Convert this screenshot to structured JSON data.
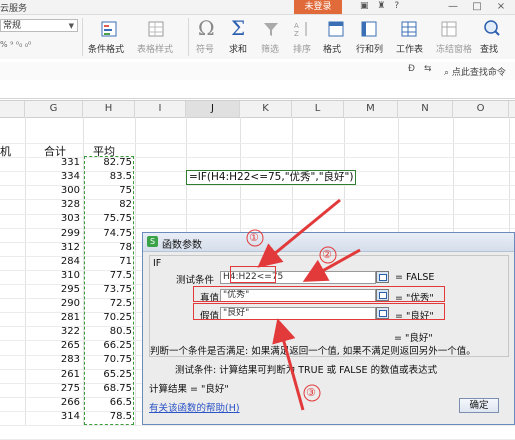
{
  "titlebar": {
    "service_label": "云服务",
    "login_label": "未登录",
    "icons": [
      "menu-icon",
      "shirt-icon",
      "help-icon"
    ],
    "window_buttons": [
      "—",
      "□",
      "×"
    ]
  },
  "ribbon": {
    "number_format": "常规",
    "number_format_row": "% ⁹ ⁰₀ ₀⁰",
    "items": [
      {
        "label": "条件格式",
        "dim": false
      },
      {
        "label": "表格样式",
        "dim": true
      },
      {
        "label": "符号",
        "dim": true
      },
      {
        "label": "求和",
        "dim": false
      },
      {
        "label": "筛选",
        "dim": true
      },
      {
        "label": "排序",
        "dim": true
      },
      {
        "label": "格式",
        "dim": false
      },
      {
        "label": "行和列",
        "dim": false
      },
      {
        "label": "工作表",
        "dim": false
      },
      {
        "label": "冻结窗格",
        "dim": true
      },
      {
        "label": "查找",
        "dim": false
      }
    ],
    "search_label": "点此查找命令"
  },
  "columns": [
    "G",
    "H",
    "I",
    "J",
    "K",
    "L",
    "M",
    "N",
    "O"
  ],
  "selected_column": "J",
  "sheet": {
    "left_partial": "机",
    "header_total": "合计",
    "header_avg": "平均",
    "total_values": [
      "331",
      "334",
      "300",
      "328",
      "303",
      "299",
      "312",
      "284",
      "310",
      "295",
      "290",
      "281",
      "322",
      "265",
      "283",
      "261",
      "275",
      "266",
      "314"
    ],
    "avg_values": [
      "82.75",
      "83.5",
      "75",
      "82",
      "75.75",
      "74.75",
      "78",
      "71",
      "77.5",
      "73.75",
      "72.5",
      "70.25",
      "80.5",
      "66.25",
      "70.75",
      "65.25",
      "68.75",
      "66.5",
      "78.5"
    ],
    "formula_cell": "=IF(H4:H22<=75,\"优秀\",\"良好\")"
  },
  "dialog": {
    "title": "函数参数",
    "function_name": "IF",
    "args": [
      {
        "label": "测试条件",
        "value": "H4:H22<=75",
        "result": "= FALSE"
      },
      {
        "label": "真值",
        "value": "\"优秀\"",
        "result": "= \"优秀\""
      },
      {
        "label": "假值",
        "value": "\"良好\"",
        "result": "= \"良好\""
      }
    ],
    "overall_result": "= \"良好\"",
    "description": "判断一个条件是否满足: 如果满足返回一个值, 如果不满足则返回另外一个值。",
    "param_desc": "测试条件:  计算结果可判断为 TRUE 或 FALSE 的数值或表达式",
    "calc_result": "计算结果 = \"良好\"",
    "help_link": "有关该函数的帮助(H)",
    "ok_label": "确定"
  },
  "annotations": [
    "①",
    "②",
    "③"
  ],
  "colors": {
    "accent_red": "#e23a3a",
    "login_orange": "#e06a3a",
    "selection_green": "#3a9c3a"
  }
}
